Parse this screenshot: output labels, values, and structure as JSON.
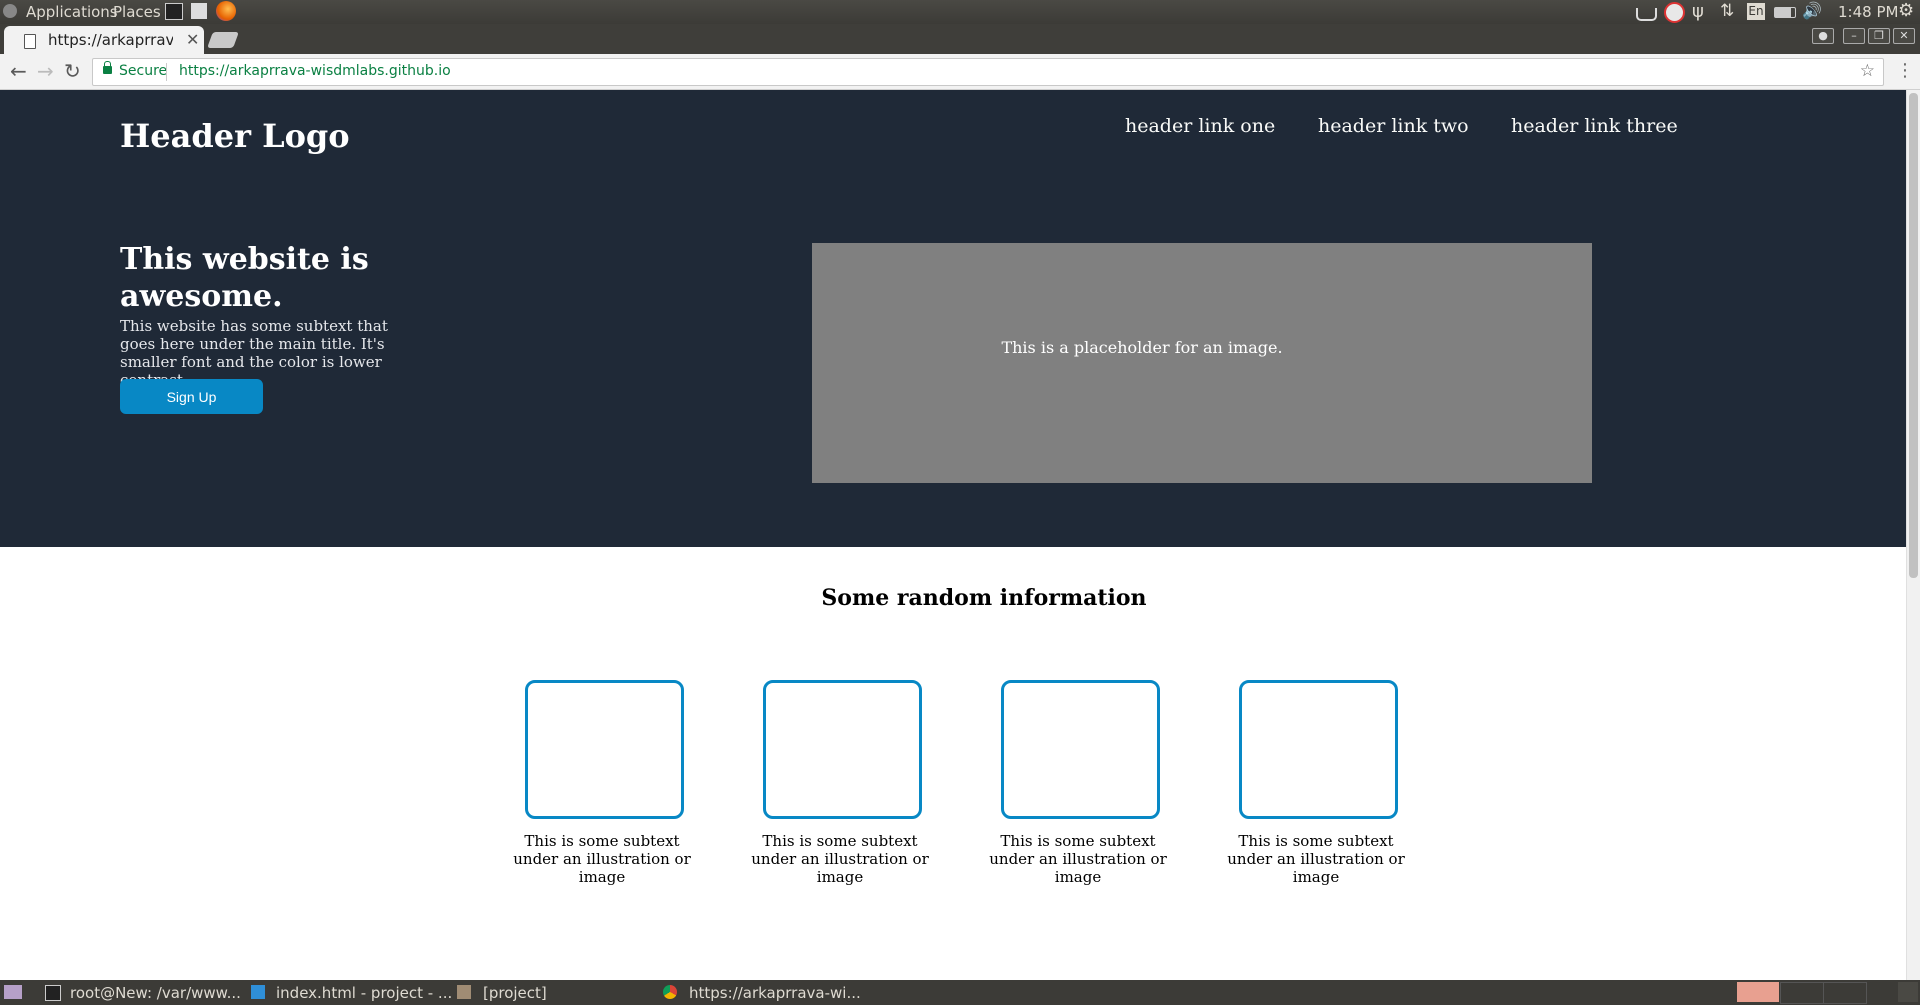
{
  "system_bar": {
    "menu_applications": "Applications",
    "menu_places": "Places",
    "time": "1:48 PM",
    "keyboard_layout": "En"
  },
  "browser": {
    "tab_title": "https://arkaprrava",
    "secure_label": "Secure",
    "url": "https://arkaprrava-wisdmlabs.github.io"
  },
  "page": {
    "header": {
      "logo": "Header Logo",
      "links": [
        "header link one",
        "header link two",
        "header link three"
      ]
    },
    "hero": {
      "title": "This website is awesome.",
      "subtext": "This website has some subtext that goes here under the main title. It's smaller font and the color is lower contrast",
      "signup_label": "Sign Up",
      "image_placeholder": "This is a placeholder for an image."
    },
    "info": {
      "title": "Some random information",
      "cards": [
        {
          "caption": "This is some subtext under an illustration or image"
        },
        {
          "caption": "This is some subtext under an illustration or image"
        },
        {
          "caption": "This is some subtext under an illustration or image"
        },
        {
          "caption": "This is some subtext under an illustration or image"
        }
      ]
    }
  },
  "taskbar": {
    "items": [
      "root@New: /var/www...",
      "index.html - project - ...",
      "[project]",
      "https://arkaprrava-wi..."
    ]
  },
  "colors": {
    "hero_bg": "#1f2937",
    "accent": "#0888c5",
    "placeholder_bg": "#808080"
  }
}
